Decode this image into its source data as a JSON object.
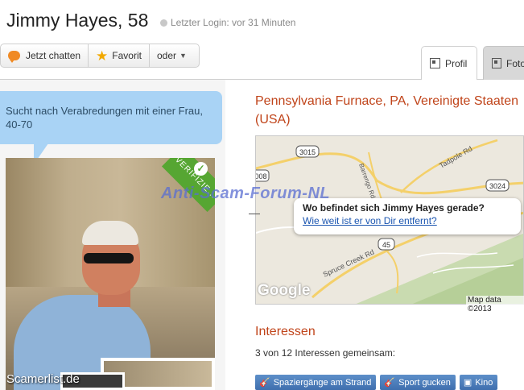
{
  "header": {
    "name_age": "Jimmy Hayes, 58",
    "last_login": "Letzter Login: vor 31 Minuten"
  },
  "actions": {
    "chat_label": "Jetzt chatten",
    "favorite_label": "Favorit",
    "more_label": "oder"
  },
  "tabs": [
    {
      "label": "Profil",
      "active": true
    },
    {
      "label": "Fotos",
      "active": false
    }
  ],
  "profile": {
    "looking_for": "Sucht nach Verabredungen mit einer Frau, 40-70",
    "verified_label": "VERIFIZIE..."
  },
  "location": {
    "text": "Pennsylvania Furnace, PA, Vereinigte Staaten (USA)"
  },
  "map": {
    "popup_title": "Wo befindet sich Jimmy Hayes gerade?",
    "popup_link": "Wie weit ist er von Dir entfernt?",
    "attribution": "Map data ©2013",
    "logo": "Google",
    "road_labels": [
      "3015",
      "3024",
      "45",
      "008",
      "Tadpole Rd",
      "Spruce Creek Rd",
      "Barrengo Rd"
    ]
  },
  "interests": {
    "title": "Interessen",
    "common": "3 von 12 Interessen gemeinsam:",
    "tags": [
      "Spaziergänge am Strand",
      "Sport gucken",
      "Kino"
    ]
  },
  "watermarks": {
    "overlay": "Anti-Scam-Forum-NL",
    "corner": "Scamerlist.de"
  },
  "colors": {
    "accent_orange": "#c0441a",
    "bubble_blue": "#a9d3f5",
    "tag_blue": "#4a7bb8",
    "verified_green": "#56a632"
  }
}
